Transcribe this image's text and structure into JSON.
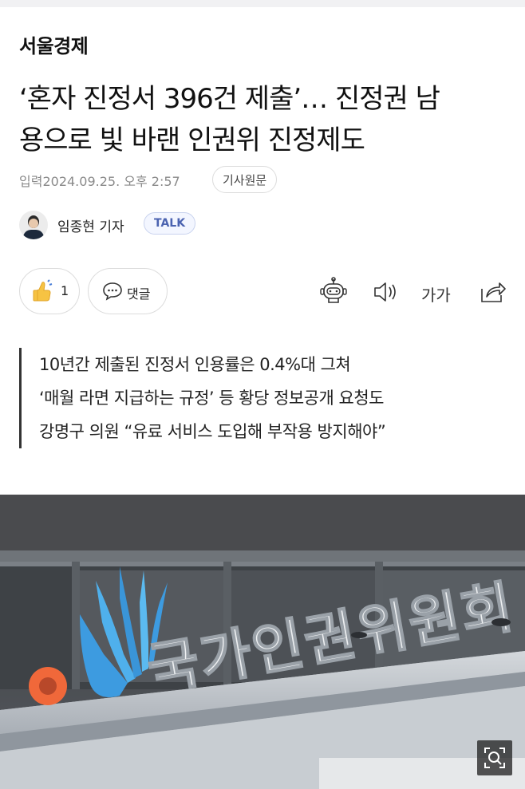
{
  "article": {
    "press": "서울경제",
    "headline_line1": "‘혼자 진정서 396건 제출’… 진정권 남",
    "headline_line2": "용으로 빛 바랜 인권위 진정제도",
    "date_label": "입력",
    "date_value": "2024.09.25. 오후 2:57",
    "original_button": "기사원문",
    "reporter": "임종현 기자",
    "talk_button": "TALK"
  },
  "actions": {
    "like_count": "1",
    "comment_label": "댓글",
    "font_label": "가가"
  },
  "summary": [
    "10년간 제출된 진정서 인용률은 0.4%대 그쳐",
    "‘매월 라면 지급하는 규정’ 등 황당 정보공개 요청도",
    "강명구 의원 “유료 서비스 도입해 부작용 방지해야”"
  ],
  "photo": {
    "sign_text": "국가인권위원회"
  },
  "colors": {
    "talk_text": "#4b63b0",
    "logo_blue": "#3d9be0",
    "logo_orange": "#f0683a"
  }
}
